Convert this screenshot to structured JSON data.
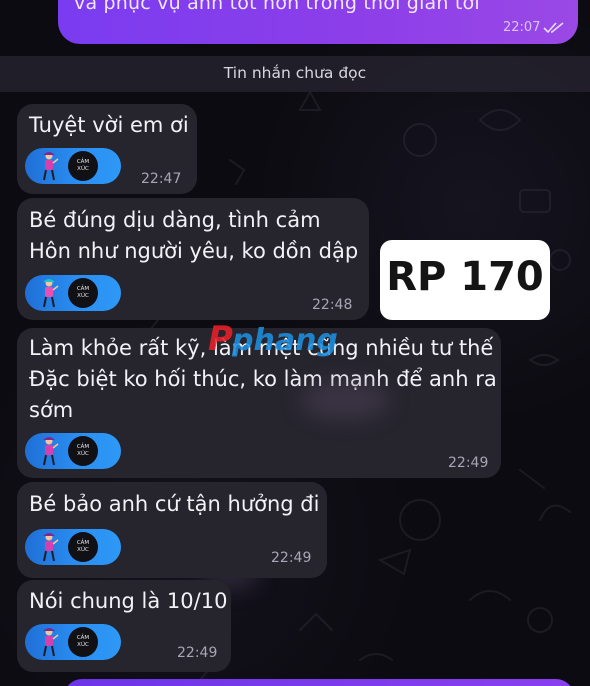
{
  "outgoing": {
    "text": "và phục vụ anh tốt hơn trong thời gian tới",
    "time": "22:07"
  },
  "unread_banner": "Tin nhắn chưa đọc",
  "sticker_label_line1": "CẢM",
  "sticker_label_line2": "XÚC",
  "messages": [
    {
      "lines": [
        "Tuyệt vời em ơi"
      ],
      "time": "22:47"
    },
    {
      "lines": [
        "Bé đúng dịu dàng, tình cảm",
        "Hôn như người yêu, ko dồn dập"
      ],
      "time": "22:48"
    },
    {
      "lines": [
        "Làm khỏe rất kỹ, làm mệt cũng nhiều tư thế",
        "Đặc biệt ko hối thúc, ko làm mạnh để anh ra",
        "sớm"
      ],
      "time": "22:49"
    },
    {
      "lines": [
        "Bé bảo anh cứ tận hưởng đi"
      ],
      "time": "22:49"
    },
    {
      "lines": [
        "Nói chung là 10/10"
      ],
      "time": "22:49"
    }
  ],
  "price_tag": "RP 170",
  "watermark": "Pphang",
  "colors": {
    "outgoing_bubble": "#8a3ff0",
    "incoming_bubble": "#26242d",
    "pill": "#2a8ef2",
    "watermark": "#e8202a"
  },
  "icons": {
    "read_receipt": "double-check-icon",
    "sticker": "dancer-figure-icon"
  }
}
